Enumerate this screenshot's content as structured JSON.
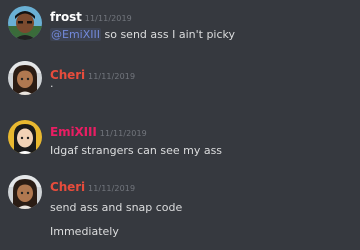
{
  "colors": {
    "background": "#36393f",
    "timestamp": "#72767d",
    "message_text": "#dcddde",
    "mention": "#7289da",
    "frost_name": "#ffffff",
    "cheri_name": "#e74c3c",
    "emixiii_name": "#e91e63"
  },
  "messages": [
    {
      "username": "frost",
      "timestamp": "11/11/2019",
      "mention": "@EmiXIII",
      "text": " so send ass I ain't picky"
    },
    {
      "username": "Cheri",
      "timestamp": "11/11/2019",
      "text": "·"
    },
    {
      "username": "EmiXIII",
      "timestamp": "11/11/2019",
      "text": "Idgaf strangers can see my ass"
    },
    {
      "username": "Cheri",
      "timestamp": "11/11/2019",
      "lines": [
        "send ass and snap code",
        "Immediately"
      ]
    }
  ]
}
